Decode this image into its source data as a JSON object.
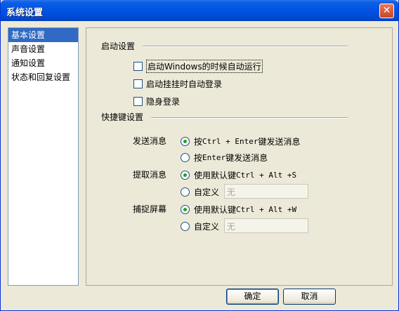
{
  "window": {
    "title": "系统设置",
    "close_glyph": "✕"
  },
  "nav": {
    "items": [
      {
        "label": "基本设置",
        "selected": true
      },
      {
        "label": "声音设置",
        "selected": false
      },
      {
        "label": "通知设置",
        "selected": false
      },
      {
        "label": "状态和回复设置",
        "selected": false
      }
    ]
  },
  "startup": {
    "title": "启动设置",
    "options": [
      {
        "label": "启动Windows的时候自动运行",
        "checked": false
      },
      {
        "label": "启动挂挂时自动登录",
        "checked": false
      },
      {
        "label": "隐身登录",
        "checked": false
      }
    ]
  },
  "hotkeys": {
    "title": "快捷键设置",
    "send": {
      "label": "发送消息",
      "opt1_prefix": "按 ",
      "opt1_key": "Ctrl + Enter",
      "opt1_suffix": " 键发送消息",
      "opt2_prefix": "按 ",
      "opt2_key": "Enter",
      "opt2_suffix": " 键发送消息"
    },
    "extract": {
      "label": "提取消息",
      "default_prefix": "使用默认键 ",
      "default_key": "Ctrl + Alt +S",
      "custom_label": "自定义",
      "custom_value": "无"
    },
    "capture": {
      "label": "捕捉屏幕",
      "default_prefix": "使用默认键 ",
      "default_key": "Ctrl + Alt +W",
      "custom_label": "自定义",
      "custom_value": "无"
    }
  },
  "buttons": {
    "ok": "确定",
    "cancel": "取消"
  }
}
